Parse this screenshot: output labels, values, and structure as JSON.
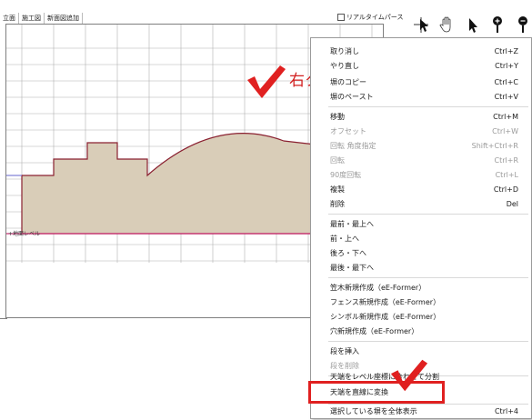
{
  "tabs": [
    "立面",
    "施工図",
    "新面図追加"
  ],
  "realtime_label": "リアルタイムパース",
  "toolbar_icons": [
    "pin-select-icon",
    "hand-pan-icon",
    "pointer-icon",
    "zoom-in-icon",
    "zoom-out-icon"
  ],
  "canvas": {
    "ground_label": "+地面レベル",
    "colors": {
      "wall_fill": "#d9cdb8",
      "wall_outline": "#8a2030",
      "ground_line": "#cc3377",
      "grid": "#b0b0b0"
    }
  },
  "annotation": {
    "text": "右クリック",
    "color": "#d21f1f"
  },
  "menu": {
    "items": [
      {
        "label": "取り消し",
        "shortcut": "Ctrl+Z",
        "disabled": false
      },
      {
        "label": "やり直し",
        "shortcut": "Ctrl+Y",
        "disabled": false
      },
      {
        "label": "塀のコピー",
        "shortcut": "Ctrl+C",
        "disabled": false
      },
      {
        "label": "塀のペースト",
        "shortcut": "Ctrl+V",
        "disabled": false
      },
      {
        "label": "移動",
        "shortcut": "Ctrl+M",
        "disabled": false
      },
      {
        "label": "オフセット",
        "shortcut": "Ctrl+W",
        "disabled": true
      },
      {
        "label": "回転 角度指定",
        "shortcut": "Shift+Ctrl+R",
        "disabled": true
      },
      {
        "label": "回転",
        "shortcut": "Ctrl+R",
        "disabled": true
      },
      {
        "label": "90度回転",
        "shortcut": "Ctrl+L",
        "disabled": true
      },
      {
        "label": "複製",
        "shortcut": "Ctrl+D",
        "disabled": false
      },
      {
        "label": "削除",
        "shortcut": "Del",
        "disabled": false
      },
      {
        "label": "最前・最上へ",
        "shortcut": "",
        "disabled": false
      },
      {
        "label": "前・上へ",
        "shortcut": "",
        "disabled": false
      },
      {
        "label": "後ろ・下へ",
        "shortcut": "",
        "disabled": false
      },
      {
        "label": "最後・最下へ",
        "shortcut": "",
        "disabled": false
      },
      {
        "label": "笠木新規作成（eE-Former）",
        "shortcut": "",
        "disabled": false
      },
      {
        "label": "フェンス新規作成（eE-Former）",
        "shortcut": "",
        "disabled": false
      },
      {
        "label": "シンボル新規作成（eE-Former）",
        "shortcut": "",
        "disabled": false
      },
      {
        "label": "穴新規作成（eE-Former）",
        "shortcut": "",
        "disabled": false
      },
      {
        "label": "段を挿入",
        "shortcut": "",
        "disabled": false
      },
      {
        "label": "段を削除",
        "shortcut": "",
        "disabled": true
      },
      {
        "label": "天端をレベル座標に合わせて分割",
        "shortcut": "",
        "disabled": false
      },
      {
        "label": "天端を直線に変換",
        "shortcut": "",
        "disabled": false
      },
      {
        "label": "選択している塀を全体表示",
        "shortcut": "Ctrl+4",
        "disabled": false
      }
    ]
  }
}
